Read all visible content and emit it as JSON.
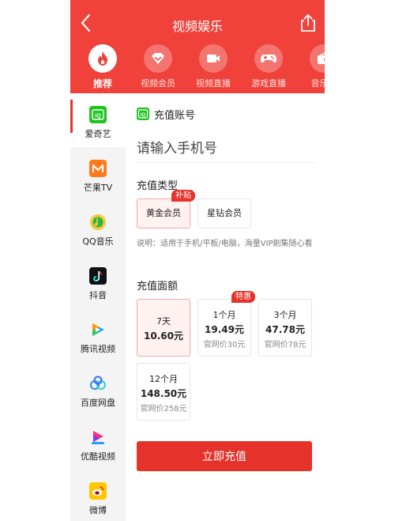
{
  "header": {
    "title": "视频娱乐",
    "back_icon": "back-arrow-icon",
    "share_icon": "share-icon",
    "bg_color": "#f0413a"
  },
  "categories": [
    {
      "label": "推荐",
      "icon": "fire-icon",
      "active": true
    },
    {
      "label": "视频会员",
      "icon": "diamond-icon",
      "active": false
    },
    {
      "label": "视频直播",
      "icon": "video-camera-icon",
      "active": false
    },
    {
      "label": "游戏直播",
      "icon": "gamepad-icon",
      "active": false
    },
    {
      "label": "音乐电",
      "icon": "radio-icon",
      "active": false
    }
  ],
  "sidebar": {
    "items": [
      {
        "label": "爱奇艺",
        "icon": "iqiyi-icon",
        "active": true
      },
      {
        "label": "芒果TV",
        "icon": "mango-tv-icon",
        "active": false
      },
      {
        "label": "QQ音乐",
        "icon": "qq-music-icon",
        "active": false
      },
      {
        "label": "抖音",
        "icon": "douyin-icon",
        "active": false
      },
      {
        "label": "腾讯视频",
        "icon": "tencent-video-icon",
        "active": false
      },
      {
        "label": "百度网盘",
        "icon": "baidu-netdisk-icon",
        "active": false
      },
      {
        "label": "优酷视频",
        "icon": "youku-icon",
        "active": false
      },
      {
        "label": "微博",
        "icon": "weibo-icon",
        "active": false
      }
    ]
  },
  "main": {
    "account_title": "充值账号",
    "account_icon": "iqiyi-icon",
    "phone_placeholder": "请输入手机号",
    "type_section": "充值类型",
    "types": [
      {
        "label": "黄金会员",
        "selected": true,
        "tag": "补贴"
      },
      {
        "label": "星钻会员",
        "selected": false,
        "tag": ""
      }
    ],
    "description": "说明：适用于手机/平板/电脑，海量VIP剧集随心看",
    "amount_section": "充值面额",
    "plans": [
      {
        "duration": "7天",
        "price": "10.60元",
        "original": "",
        "selected": true,
        "tag": ""
      },
      {
        "duration": "1个月",
        "price": "19.49元",
        "original": "官网价30元",
        "selected": false,
        "tag": "特惠"
      },
      {
        "duration": "3个月",
        "price": "47.78元",
        "original": "官网价78元",
        "selected": false,
        "tag": ""
      },
      {
        "duration": "12个月",
        "price": "148.50元",
        "original": "官网价258元",
        "selected": false,
        "tag": ""
      }
    ],
    "submit_label": "立即充值",
    "accent_color": "#e5332c"
  }
}
